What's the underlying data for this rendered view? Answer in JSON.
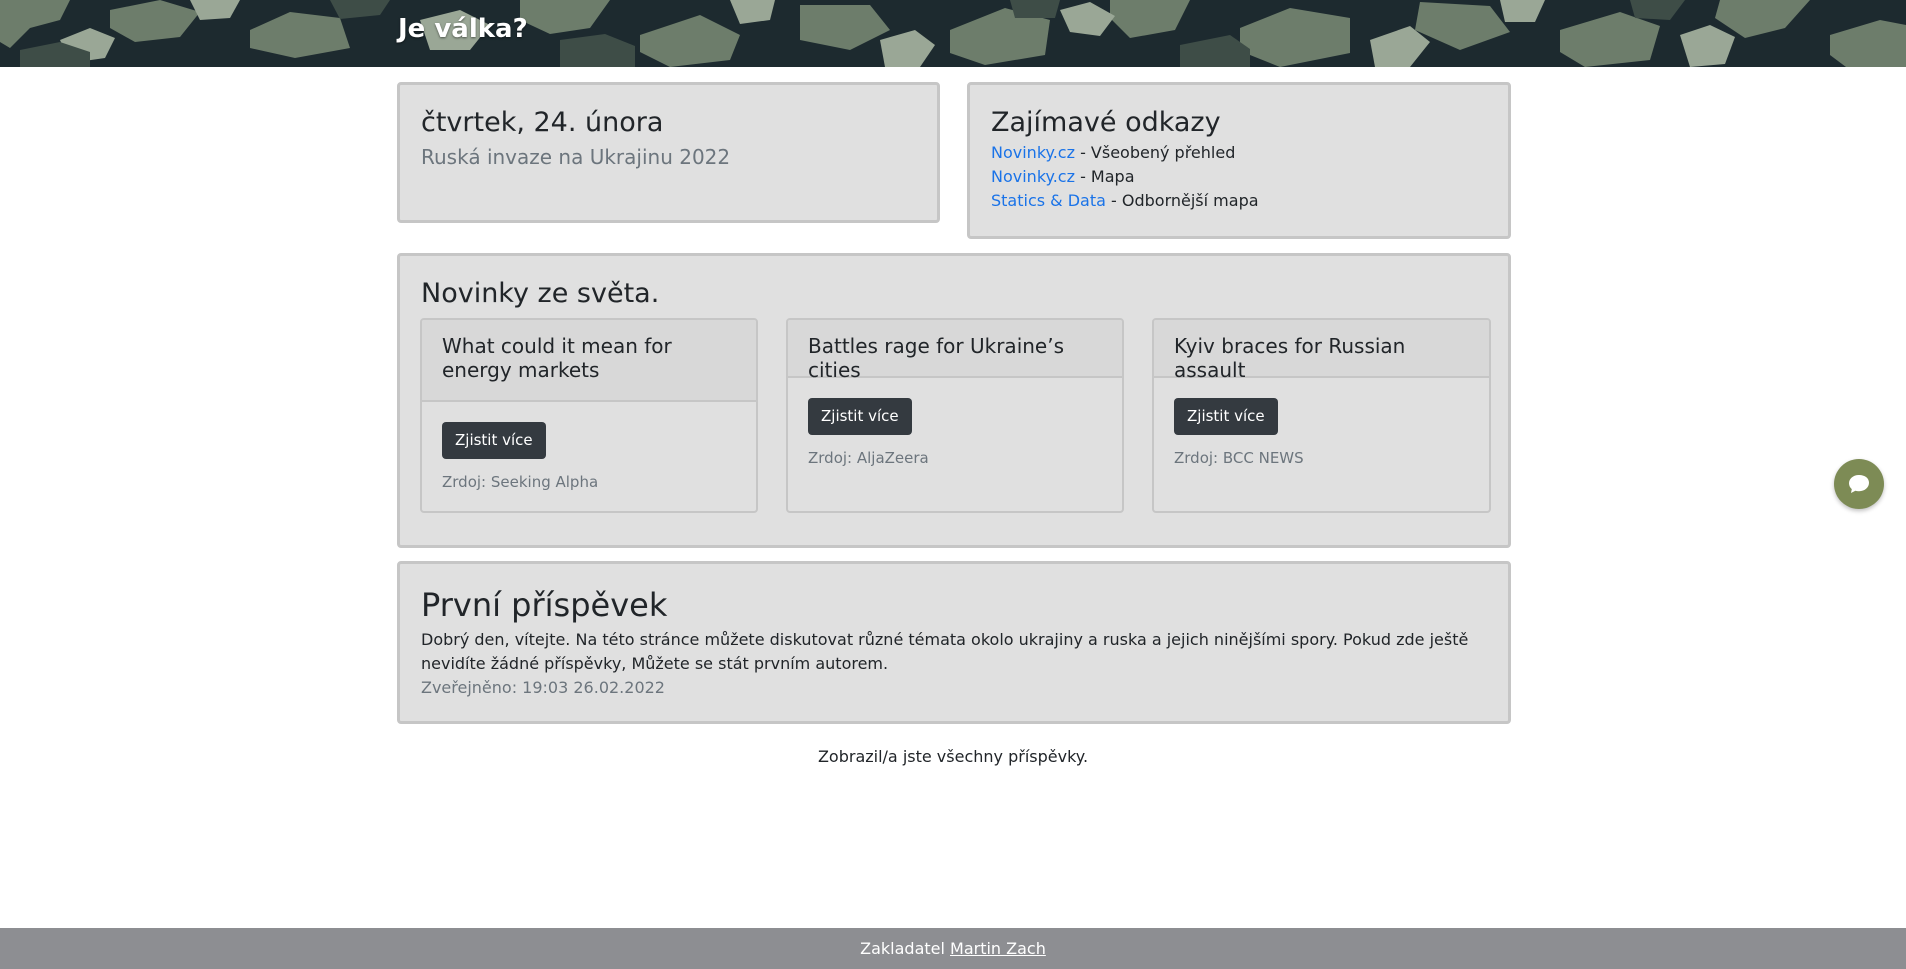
{
  "header": {
    "brand": "Je válka?"
  },
  "date_card": {
    "title": "čtvrtek, 24. února",
    "subtitle": "Ruská invaze na Ukrajinu 2022"
  },
  "links_card": {
    "title": "Zajímavé odkazy",
    "links": [
      {
        "link_text": "Novinky.cz",
        "description": " - Všeobený přehled"
      },
      {
        "link_text": "Novinky.cz",
        "description": " - Mapa"
      },
      {
        "link_text": "Statics & Data",
        "description": " - Odbornější mapa"
      }
    ]
  },
  "news_section": {
    "title": "Novinky ze světa.",
    "articles": [
      {
        "headline": "What could it mean for energy markets",
        "button": "Zjistit více",
        "source": "Zrdoj: Seeking Alpha"
      },
      {
        "headline": "Battles rage for Ukraine’s cities",
        "button": "Zjistit více",
        "source": "Zrdoj: AljaZeera"
      },
      {
        "headline": "Kyiv braces for Russian assault",
        "button": "Zjistit více",
        "source": "Zrdoj: BCC NEWS"
      }
    ]
  },
  "post": {
    "title": "První příspěvek",
    "body": "Dobrý den, vítejte. Na této stránce můžete diskutovat různé témata okolo ukrajiny a ruska a jejich ninějšími spory. Pokud zde ještě nevidíte žádné příspěvky, Můžete se stát prvním autorem.",
    "published": "Zveřejněno: 19:03 26.02.2022"
  },
  "all_posts_text": "Zobrazil/a jste všechny příspěvky.",
  "chat": {
    "icon": "chat-bubble-icon"
  },
  "footer": {
    "prefix": "Zakladatel ",
    "author_link": "Martin Zach"
  },
  "colors": {
    "card_bg": "#e0e0e0",
    "button_dark": "#343a40",
    "link": "#1a73e8",
    "chat_button": "#7d8b55",
    "footer_bg": "#8d8e92"
  }
}
